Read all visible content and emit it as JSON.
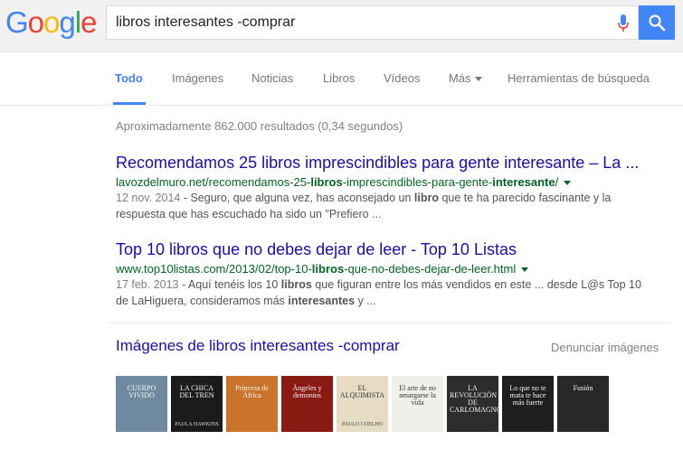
{
  "logo": {
    "letters": [
      "G",
      "o",
      "o",
      "g",
      "l",
      "e"
    ],
    "colors": [
      "#4285f4",
      "#ea4335",
      "#fbbc05",
      "#4285f4",
      "#34a853",
      "#ea4335"
    ]
  },
  "search": {
    "query": "libros interesantes -comprar"
  },
  "tabs": [
    {
      "label": "Todo",
      "active": true
    },
    {
      "label": "Imágenes"
    },
    {
      "label": "Noticias"
    },
    {
      "label": "Libros"
    },
    {
      "label": "Vídeos"
    },
    {
      "label": "Más"
    },
    {
      "label": "Herramientas de búsqueda"
    }
  ],
  "stats": "Aproximadamente 862.000 resultados (0,34 segundos)",
  "results": [
    {
      "title": "Recomendamos 25 libros imprescindibles para gente interesante – La ...",
      "url_parts": [
        "lavozdelmuro.net/recomendamos-25-",
        "libros",
        "-imprescindibles-para-gente-",
        "interesante",
        "/"
      ],
      "date": "12 nov. 2014",
      "snippet_parts": [
        " - Seguro, que alguna vez, has aconsejado un ",
        "libro",
        " que te ha parecido fascinante y la respuesta que has escuchado ha sido un \"Prefiero ..."
      ]
    },
    {
      "title": "Top 10 libros que no debes dejar de leer - Top 10 Listas",
      "url_parts": [
        "www.top10listas.com/2013/02/top-10-",
        "libros",
        "-que-no-debes-dejar-de-leer.html"
      ],
      "date": "17 feb. 2013",
      "snippet_parts": [
        " - Aquí tenéis los 10 ",
        "libros",
        " que figuran entre los más vendidos en este ... desde L@s Top 10 de LaHiguera, consideramos más ",
        "interesantes",
        " y ..."
      ]
    }
  ],
  "images_section": {
    "title": "Imágenes de libros interesantes -comprar",
    "report": "Denunciar imágenes",
    "thumbs": [
      {
        "text": "CUERPO VIVIDO",
        "bg": "#6f8aa0"
      },
      {
        "text": "LA CHICA DEL TREN",
        "sub": "PAULA HAWKINS",
        "bg": "#1b1b1b"
      },
      {
        "text": "Princesa de África",
        "bg": "#c9732d"
      },
      {
        "text": "Ángeles y demonios",
        "bg": "#8a1a14"
      },
      {
        "text": "EL ALQUIMISTA",
        "sub": "PAULO COELHO",
        "bg": "#e6dcc4"
      },
      {
        "text": "El arte de no amargarse la vida",
        "bg": "#f1efe9"
      },
      {
        "text": "LA REVOLUCIÓN DE CARLOMAGNO",
        "bg": "#2d2d2d"
      },
      {
        "text": "Lo que no te mata te hace más fuerte",
        "bg": "#1f1f1f"
      },
      {
        "text": "Fusión",
        "bg": "#282828"
      }
    ]
  }
}
